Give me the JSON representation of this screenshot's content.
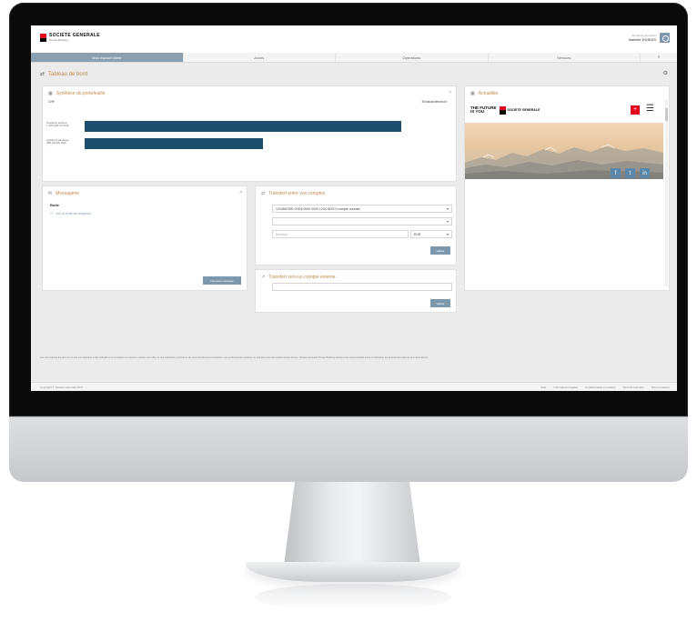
{
  "header": {
    "brand_name": "SOCIETE GENERALE",
    "brand_sub": "Private Banking",
    "user_top": "Dernière connexion",
    "user_name": "Isabelle DUBOIS"
  },
  "nav": {
    "tabs": [
      {
        "label": "Mon espace client",
        "active": true
      },
      {
        "label": "Avoirs",
        "active": false
      },
      {
        "label": "Opérations",
        "active": false
      },
      {
        "label": "Services",
        "active": false
      }
    ],
    "extra": "»"
  },
  "page": {
    "title": "Tableau de bord"
  },
  "synthese": {
    "title": "Synthèse du portefeuille",
    "left_label": "CHF",
    "right_label": "Exhaustivité/avoir",
    "rows": [
      {
        "label_a": "Positions actives",
        "label_b": "1 325 405,33 CHF",
        "label_c": "-",
        "value": 0.87
      },
      {
        "label_a": "Positions passives",
        "label_b": "385 213,00 CHF",
        "label_c": "-",
        "value": 0.49
      }
    ]
  },
  "messagerie": {
    "title": "Messagerie",
    "subtitle": "Boîte",
    "link": "Voir la boîte de réception",
    "button": "Nouveau message"
  },
  "transfer": {
    "title": "Transfert entre vos comptes",
    "from_value": "1234567890 CH04 0000 0000 1234 5678 9 compte courant",
    "to_value": "",
    "amount_placeholder": "Montant",
    "currency": "EUR",
    "button": "Valider"
  },
  "external": {
    "title": "Transfert vers un compte externe",
    "button": "Valider"
  },
  "news": {
    "title": "Actualités",
    "brand_line1": "THE FUTURE",
    "brand_line2": "IS YOU",
    "brand_tag": "SOCIETE GENERALE",
    "red_icon": "+",
    "menu_icon": "☰",
    "share_icons": [
      "f",
      "t",
      "in"
    ],
    "share_color": "#5b87a8"
  },
  "footer": {
    "text": "Les informations figurant sur ce site sont données à titre indicatif et ne constituent en aucune manière une offre ou une sollicitation d'achat ou de vente d'instruments financiers. Les performances passées ne préjugent pas des performances futures. Société Générale Private Banking décline toute responsabilité quant à l'utilisation qui pourrait être faite de ces informations.",
    "left": "Copyright © Société Générale 2017",
    "links": [
      "Aide",
      "Informations légales",
      "Confidentialité et cookies",
      "Sécurité bancaire",
      "Nous contacter"
    ]
  },
  "colors": {
    "accent": "#c08a4a",
    "bar": "#1d4e6b",
    "button": "#7d98ad",
    "brand_red": "#e2001a"
  }
}
